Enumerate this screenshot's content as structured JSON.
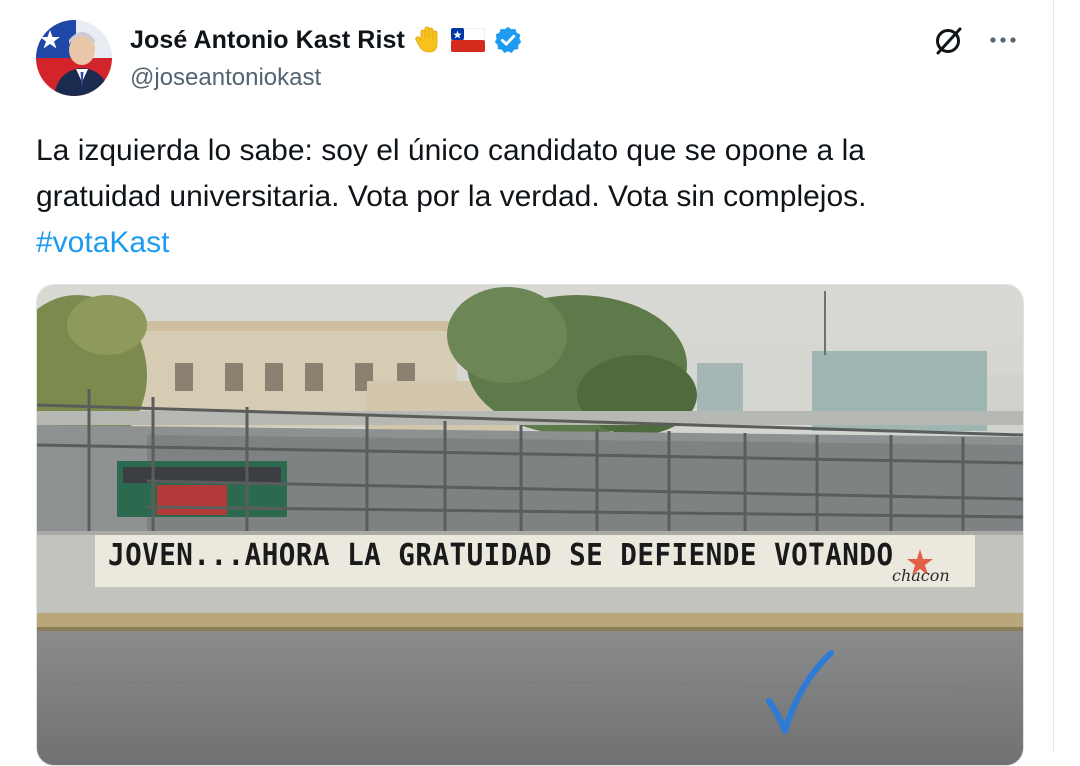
{
  "author": {
    "display_name": "José Antonio Kast Rist",
    "handle": "@joseantoniokast",
    "badges": [
      "raised-hand-emoji",
      "chile-flag-emoji",
      "verified-badge-icon"
    ]
  },
  "tweet": {
    "text_line1": "La izquierda lo sabe: soy el único candidato que se opone a la",
    "text_line2": "gratuidad universitaria. Vota por la verdad. Vota sin complejos.",
    "hashtag": "#votaKast"
  },
  "media": {
    "mural_text": "JOVEN...AHORA LA GRATUIDAD SE DEFIENDE VOTANDO",
    "signature": "chacon"
  },
  "icons": {
    "grok": "grok-icon",
    "more": "more-options-icon",
    "checkmark": "checkmark-icon"
  },
  "colors": {
    "link": "#1d9bf0",
    "verified": "#1d9bf0",
    "text": "#0f1419",
    "secondary": "#536471",
    "checkmark": "#2e7bd6"
  }
}
